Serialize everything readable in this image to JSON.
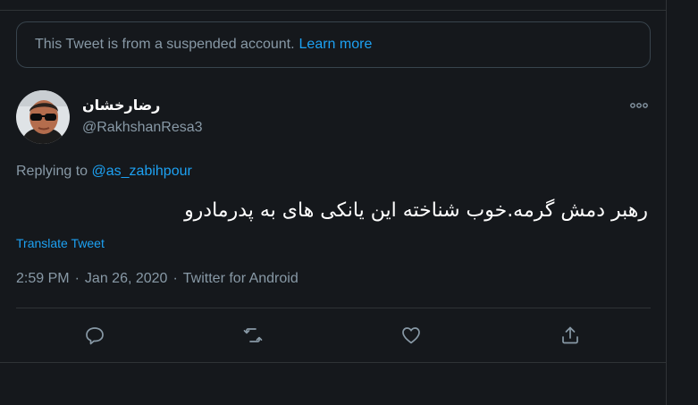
{
  "notice": {
    "text": "This Tweet is from a suspended account.",
    "link": "Learn more"
  },
  "author": {
    "name": "رضارخشان",
    "handle": "@RakhshanResa3"
  },
  "reply": {
    "prefix": "Replying to ",
    "mention": "@as_zabihpour"
  },
  "tweet": {
    "text": "رهبر دمش گرمه.خوب شناخته این یانکی های به پدرمادرو",
    "translate": "Translate Tweet"
  },
  "meta": {
    "time": "2:59 PM",
    "date": "Jan 26, 2020",
    "source": "Twitter for Android",
    "separator": "·"
  },
  "icons": {
    "more": "more-icon",
    "reply": "reply-icon",
    "retweet": "retweet-icon",
    "like": "like-icon",
    "share": "share-icon"
  },
  "colors": {
    "background": "#15181c",
    "accent": "#1da1f2",
    "secondary": "#8899a6",
    "border": "#2f3336"
  }
}
